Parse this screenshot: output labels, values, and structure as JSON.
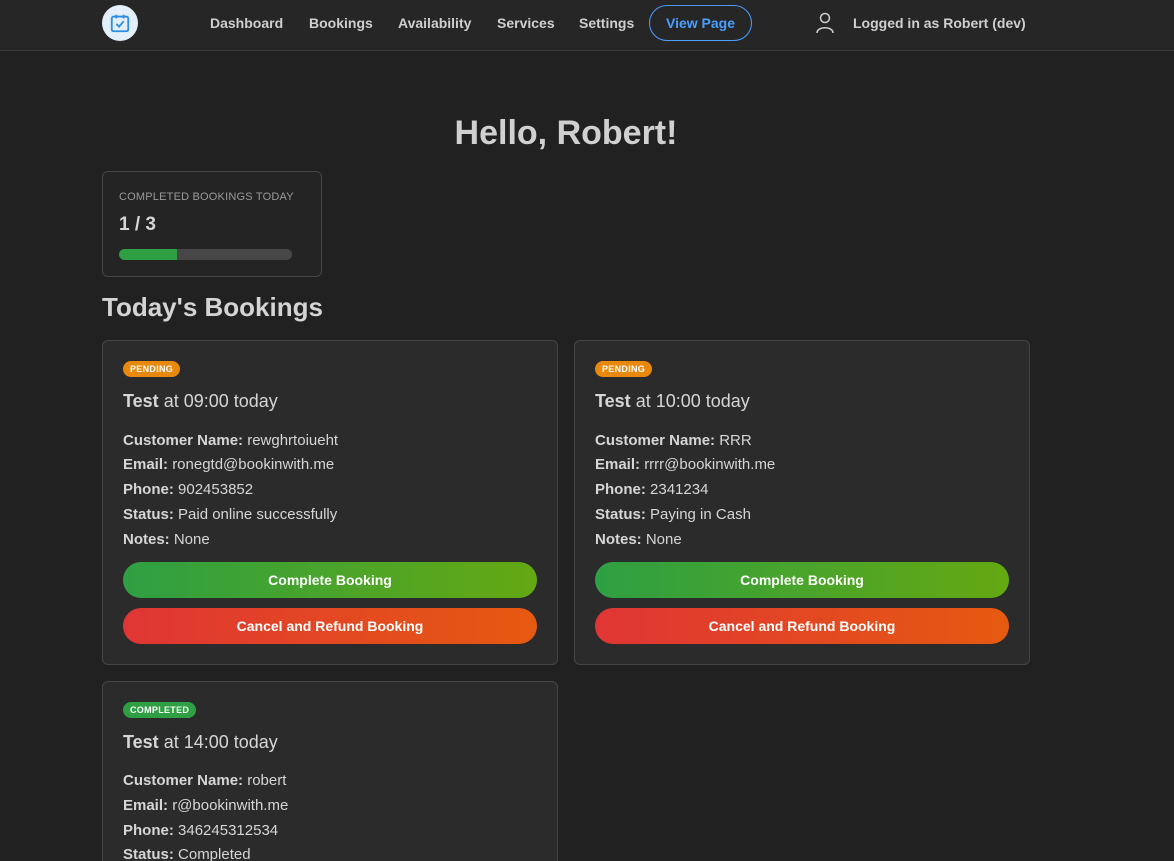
{
  "nav": {
    "items": [
      "Dashboard",
      "Bookings",
      "Availability",
      "Services",
      "Settings"
    ],
    "view_page": "View Page",
    "user_label": "Logged in as Robert (dev)",
    "accent": "#4a9eff"
  },
  "greeting": "Hello, Robert!",
  "stats": {
    "label": "COMPLETED BOOKINGS TODAY",
    "value": "1 / 3",
    "progress_fraction": 0.333
  },
  "section_title": "Today's Bookings",
  "field_labels": {
    "customer": "Customer Name:",
    "email": "Email:",
    "phone": "Phone:",
    "status": "Status:",
    "notes": "Notes:"
  },
  "buttons": {
    "complete": "Complete Booking",
    "cancel": "Cancel and Refund Booking"
  },
  "bookings": [
    {
      "badge": "PENDING",
      "service": "Test",
      "time": "at 09:00 today",
      "customer": "rewghrtoiueht",
      "email": "ronegtd@bookinwith.me",
      "phone": "902453852",
      "status": "Paid online successfully",
      "notes": "None"
    },
    {
      "badge": "PENDING",
      "service": "Test",
      "time": "at 10:00 today",
      "customer": "RRR",
      "email": "rrrr@bookinwith.me",
      "phone": "2341234",
      "status": "Paying in Cash",
      "notes": "None"
    },
    {
      "badge": "COMPLETED",
      "service": "Test",
      "time": "at 14:00 today",
      "customer": "robert",
      "email": "r@bookinwith.me",
      "phone": "346245312534",
      "status": "Completed"
    }
  ]
}
